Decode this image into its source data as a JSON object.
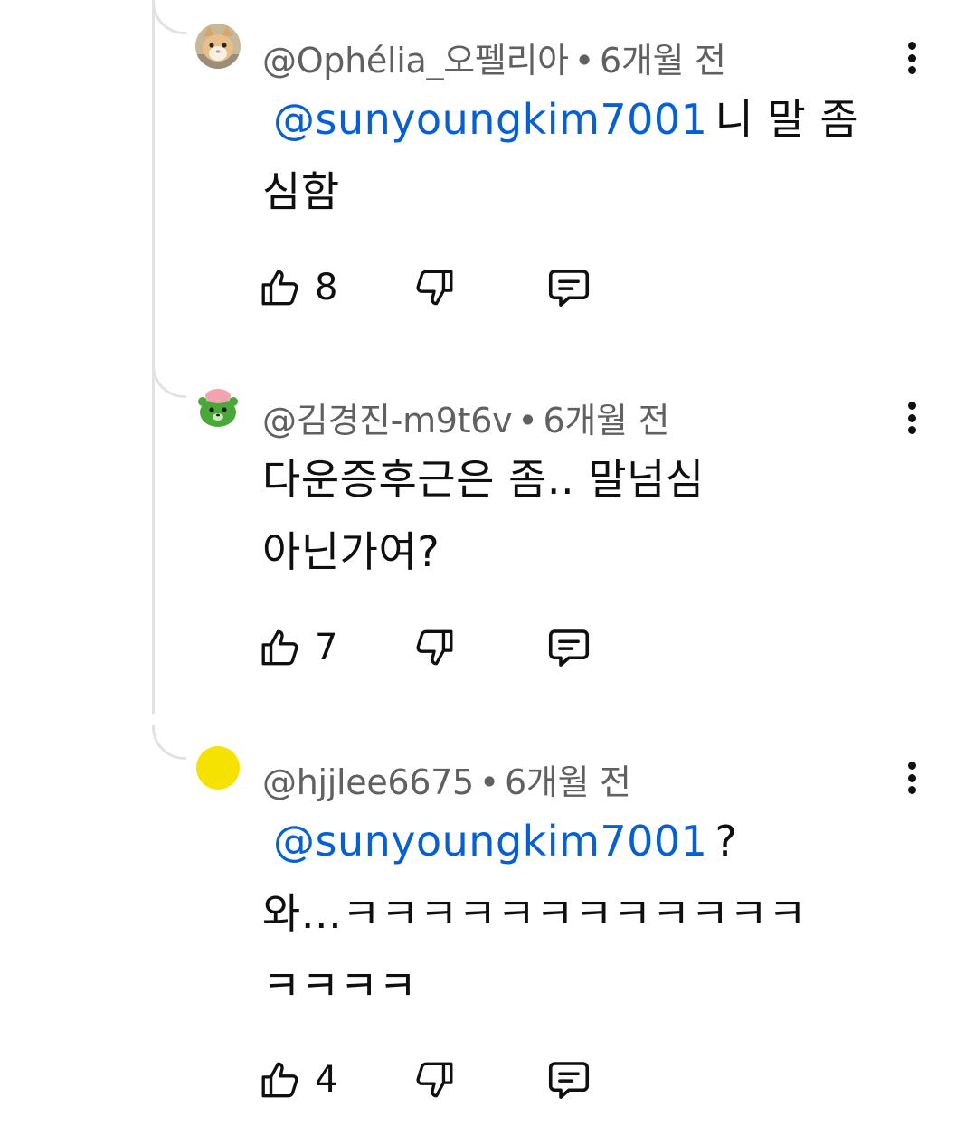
{
  "comments": [
    {
      "author": "@Ophélia_오펠리아",
      "separator": "•",
      "time": "6개월 전",
      "mention": "@sunyoungkim7001",
      "line1": "니 말 좀",
      "line2": "심함",
      "likes": "8",
      "avatar": "cat-photo"
    },
    {
      "author": "@김경진-m9t6v",
      "separator": "•",
      "time": "6개월 전",
      "line1": "다운증후근은 좀.. 말넘심",
      "line2": "아닌가여?",
      "likes": "7",
      "avatar": "green-character"
    },
    {
      "author": "@hjjlee6675",
      "separator": "•",
      "time": "6개월 전",
      "mention": "@sunyoungkim7001",
      "line1": "?",
      "line2": "와...ㅋㅋㅋㅋㅋㅋㅋㅋㅋㅋㅋㅋ",
      "line3": "ㅋㅋㅋㅋ",
      "likes": "4",
      "avatar": "yellow-circle"
    }
  ],
  "colors": {
    "mention": "#065fd4",
    "meta": "#606060",
    "text": "#0f0f0f",
    "thread_line": "#e2e2e2",
    "yellow_avatar": "#f5e200"
  },
  "icons": [
    "thumbs-up-icon",
    "thumbs-down-icon",
    "reply-icon",
    "more-vert-icon"
  ]
}
